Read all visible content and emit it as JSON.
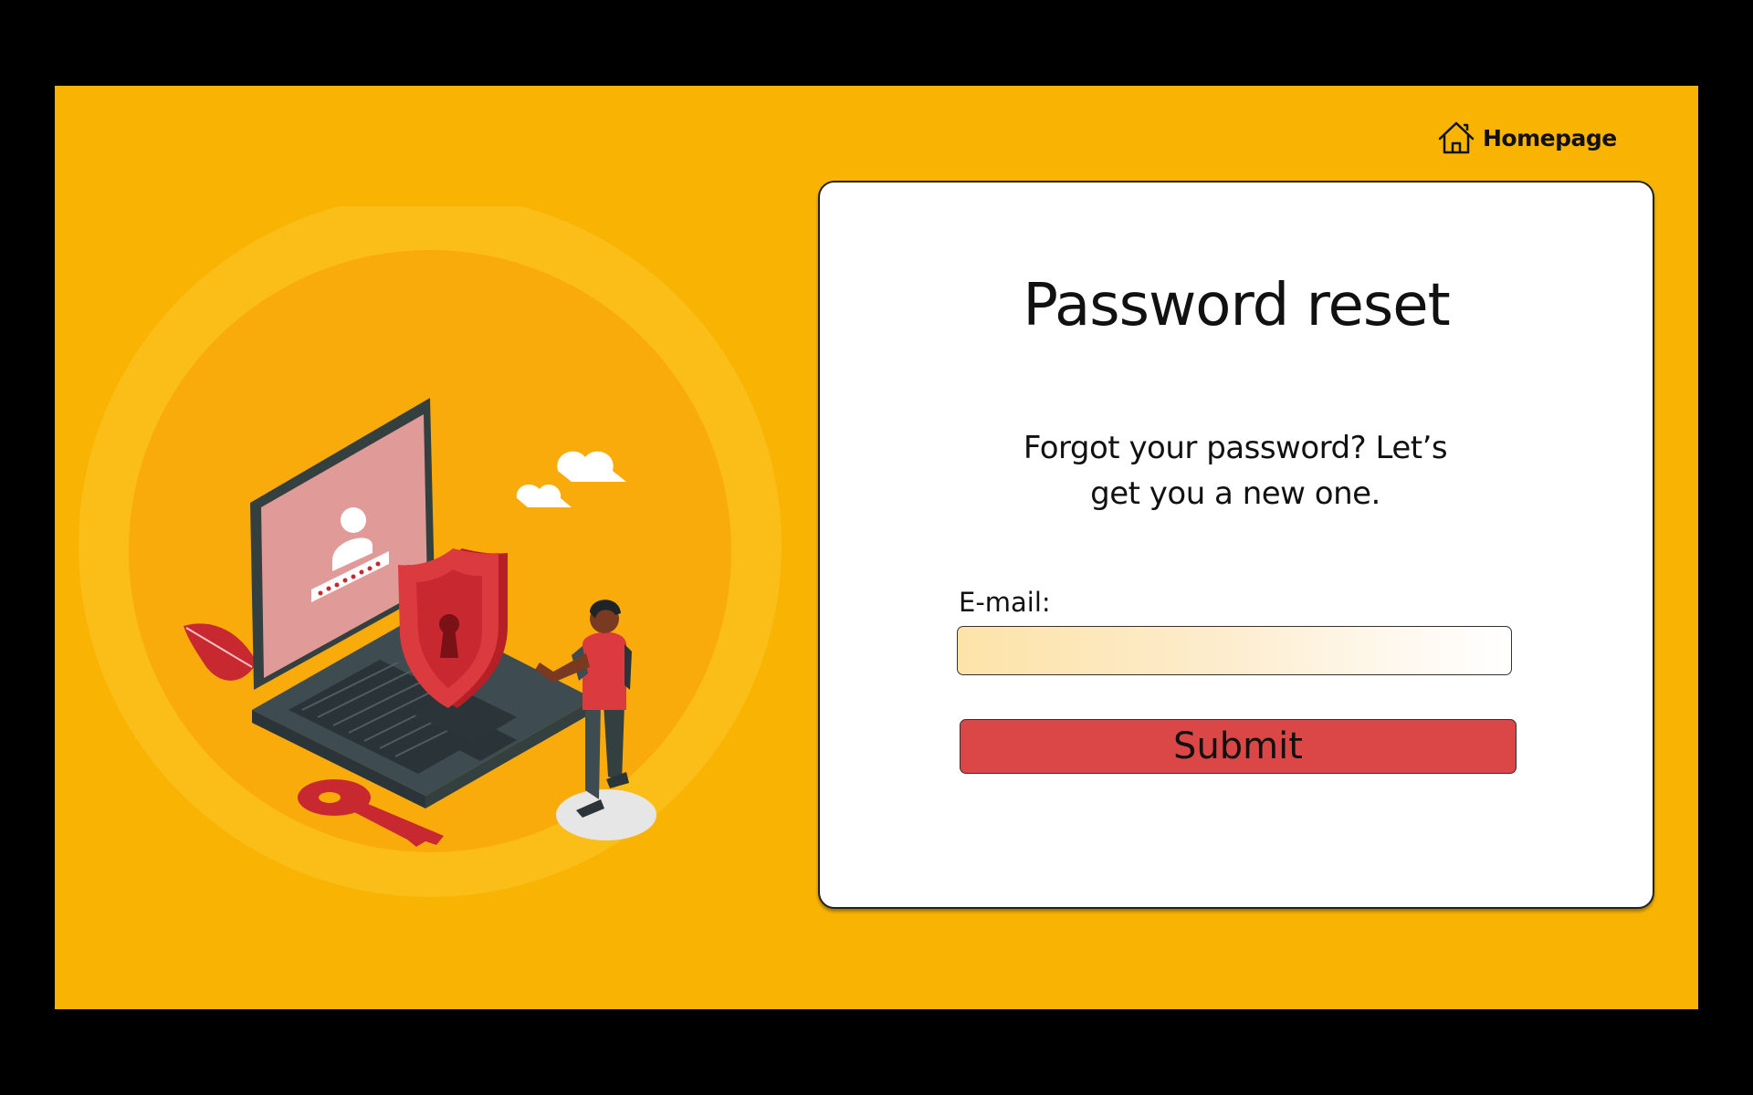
{
  "nav": {
    "home_label": "Homepage",
    "home_icon": "house-icon"
  },
  "card": {
    "title": "Password reset",
    "subtitle": "Forgot your password? Let’s get you a new one.",
    "email_label": "E-mail:",
    "email_value": "",
    "email_placeholder": "",
    "submit_label": "Submit"
  },
  "illustration": {
    "icons": [
      "laptop-icon",
      "shield-icon",
      "key-icon",
      "person-icon",
      "cloud-icon",
      "leaf-icon",
      "user-avatar-icon"
    ],
    "password_mask": "••••••••"
  },
  "colors": {
    "background": "#f9b403",
    "frame": "#000000",
    "card": "#ffffff",
    "submit": "#db4646",
    "accent_red": "#c8282f",
    "laptop_screen": "#e09a97"
  }
}
